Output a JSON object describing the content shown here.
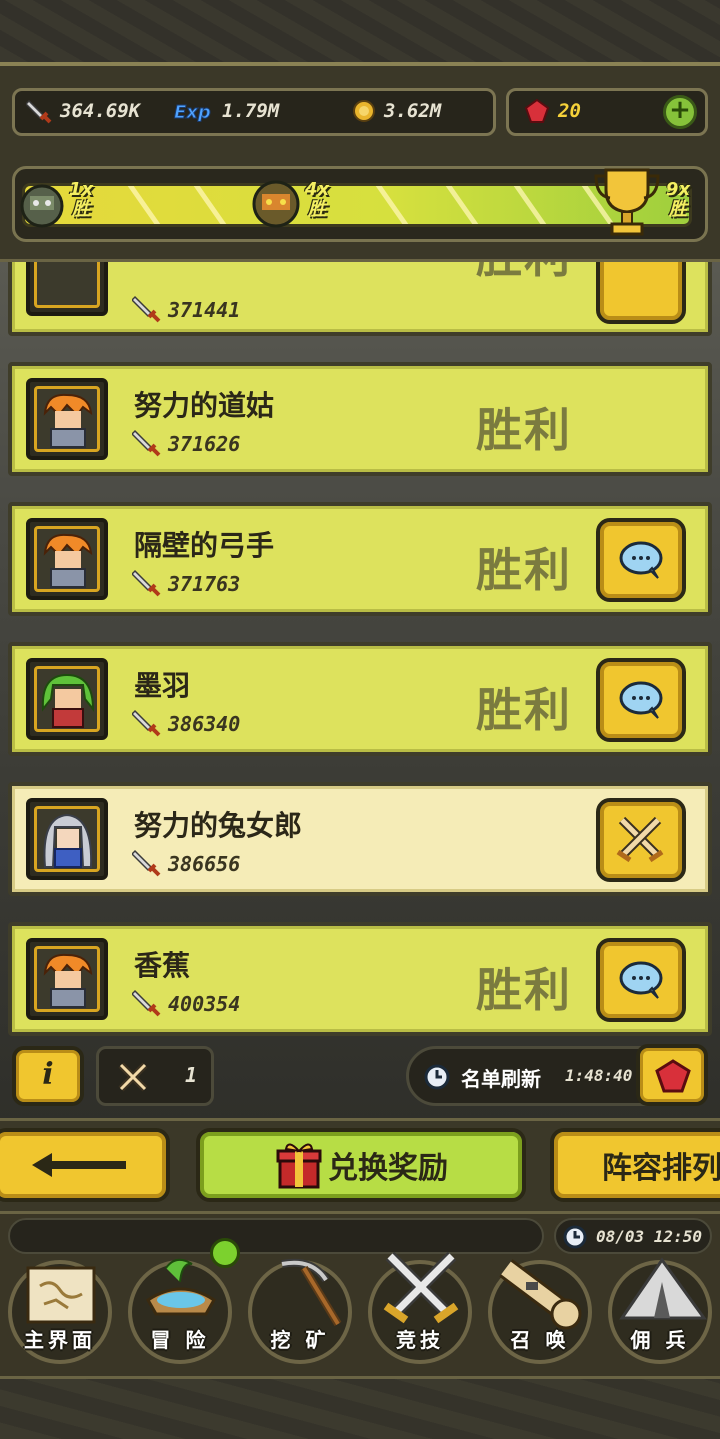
{
  "stats": {
    "power": "364.69K",
    "exp": "1.79M",
    "gold": "3.62M",
    "gems": "20"
  },
  "progress": {
    "milestones": [
      {
        "mult": "1x",
        "label": "胜"
      },
      {
        "mult": "4x",
        "label": "胜"
      },
      {
        "mult": "9x",
        "label": "胜"
      }
    ]
  },
  "opponents": [
    {
      "name": "",
      "power": "371441",
      "result": "胜利",
      "action": "chat"
    },
    {
      "name": "努力的道姑",
      "power": "371626",
      "result": "胜利",
      "action": ""
    },
    {
      "name": "隔壁的弓手",
      "power": "371763",
      "result": "胜利",
      "action": "chat"
    },
    {
      "name": "墨羽",
      "power": "386340",
      "result": "胜利",
      "action": "chat"
    },
    {
      "name": "努力的兔女郎",
      "power": "386656",
      "result": "",
      "action": "fight"
    },
    {
      "name": "香蕉",
      "power": "400354",
      "result": "胜利",
      "action": "chat"
    }
  ],
  "bottom_strip": {
    "info": "i",
    "tickets": "1",
    "refresh_label": "名单刷新",
    "refresh_time": "1:48:40"
  },
  "buttons": {
    "exchange": "兑换奖励",
    "lineup": "阵容排列"
  },
  "clock": "08/03 12:50",
  "nav": [
    {
      "label": "主界面"
    },
    {
      "label": "冒 险"
    },
    {
      "label": "挖 矿"
    },
    {
      "label": "竞技"
    },
    {
      "label": "召 唤"
    },
    {
      "label": "佣 兵"
    }
  ],
  "colors": {
    "row_bg": "#dde25d",
    "row_self_bg": "#f5ecb7",
    "result_text": "#7b7b3f",
    "button_yellow": "#f0c62f",
    "button_green": "#b7dd45"
  }
}
